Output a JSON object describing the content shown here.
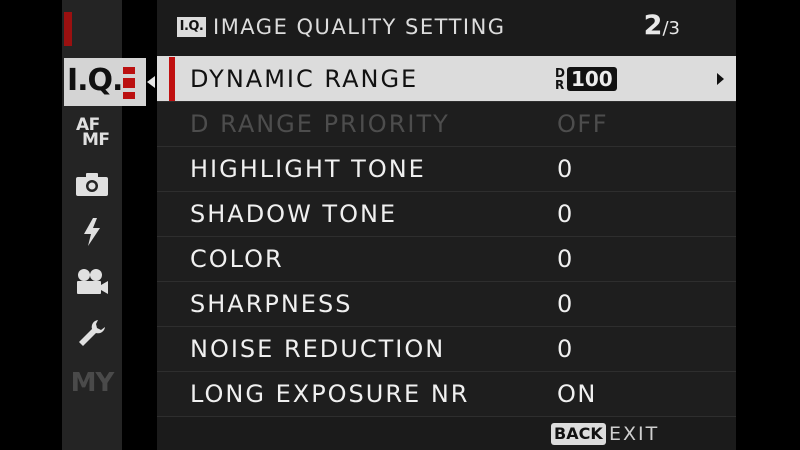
{
  "sidebar": {
    "tabs": [
      {
        "id": "image-quality",
        "label": "I.Q.",
        "active": true
      },
      {
        "id": "af-mf",
        "label_top": "AF",
        "label_bottom": "MF"
      },
      {
        "id": "shooting",
        "icon": "camera-icon"
      },
      {
        "id": "flash",
        "icon": "flash-icon"
      },
      {
        "id": "movie",
        "icon": "movie-camera-icon"
      },
      {
        "id": "setup",
        "icon": "wrench-icon"
      },
      {
        "id": "my-menu",
        "label": "MY"
      }
    ]
  },
  "header": {
    "badge": "I.Q.",
    "title": "IMAGE QUALITY SETTING",
    "page_current": "2",
    "page_total": "/3"
  },
  "menu": {
    "items": [
      {
        "label": "DYNAMIC RANGE",
        "value_top": "D",
        "value_bottom": "R",
        "value_number": "100",
        "selected": true,
        "has_submenu": true
      },
      {
        "label": "D RANGE PRIORITY",
        "value": "OFF",
        "disabled": true
      },
      {
        "label": "HIGHLIGHT TONE",
        "value": "0"
      },
      {
        "label": "SHADOW TONE",
        "value": "0"
      },
      {
        "label": "COLOR",
        "value": "0"
      },
      {
        "label": "SHARPNESS",
        "value": "0"
      },
      {
        "label": "NOISE REDUCTION",
        "value": "0"
      },
      {
        "label": "LONG EXPOSURE NR",
        "value": "ON"
      }
    ]
  },
  "footer": {
    "back_label": "BACK",
    "exit_label": "EXIT"
  },
  "colors": {
    "accent_red": "#c01010",
    "selected_row": "#dcdcdc",
    "panel_background": "#1b1b1b",
    "disabled_text": "#4d4d4d"
  }
}
